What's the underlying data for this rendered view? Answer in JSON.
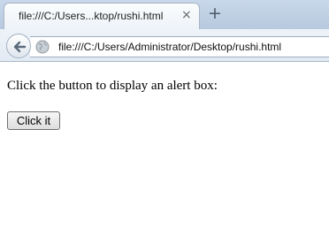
{
  "tab": {
    "title": "file:///C:/Users...ktop/rushi.html",
    "close_glyph": "×"
  },
  "newtab": {
    "glyph": "+"
  },
  "navbar": {
    "url": "file:///C:/Users/Administrator/Desktop/rushi.html"
  },
  "page": {
    "paragraph": "Click the button to display an alert box:",
    "button_label": "Click it"
  },
  "colors": {
    "tabstrip": "#b7c9df",
    "accent": "#3b77c6"
  },
  "icons": {
    "back": "back-arrow-icon",
    "site": "globe-icon",
    "close": "close-icon",
    "new_tab": "plus-icon"
  }
}
